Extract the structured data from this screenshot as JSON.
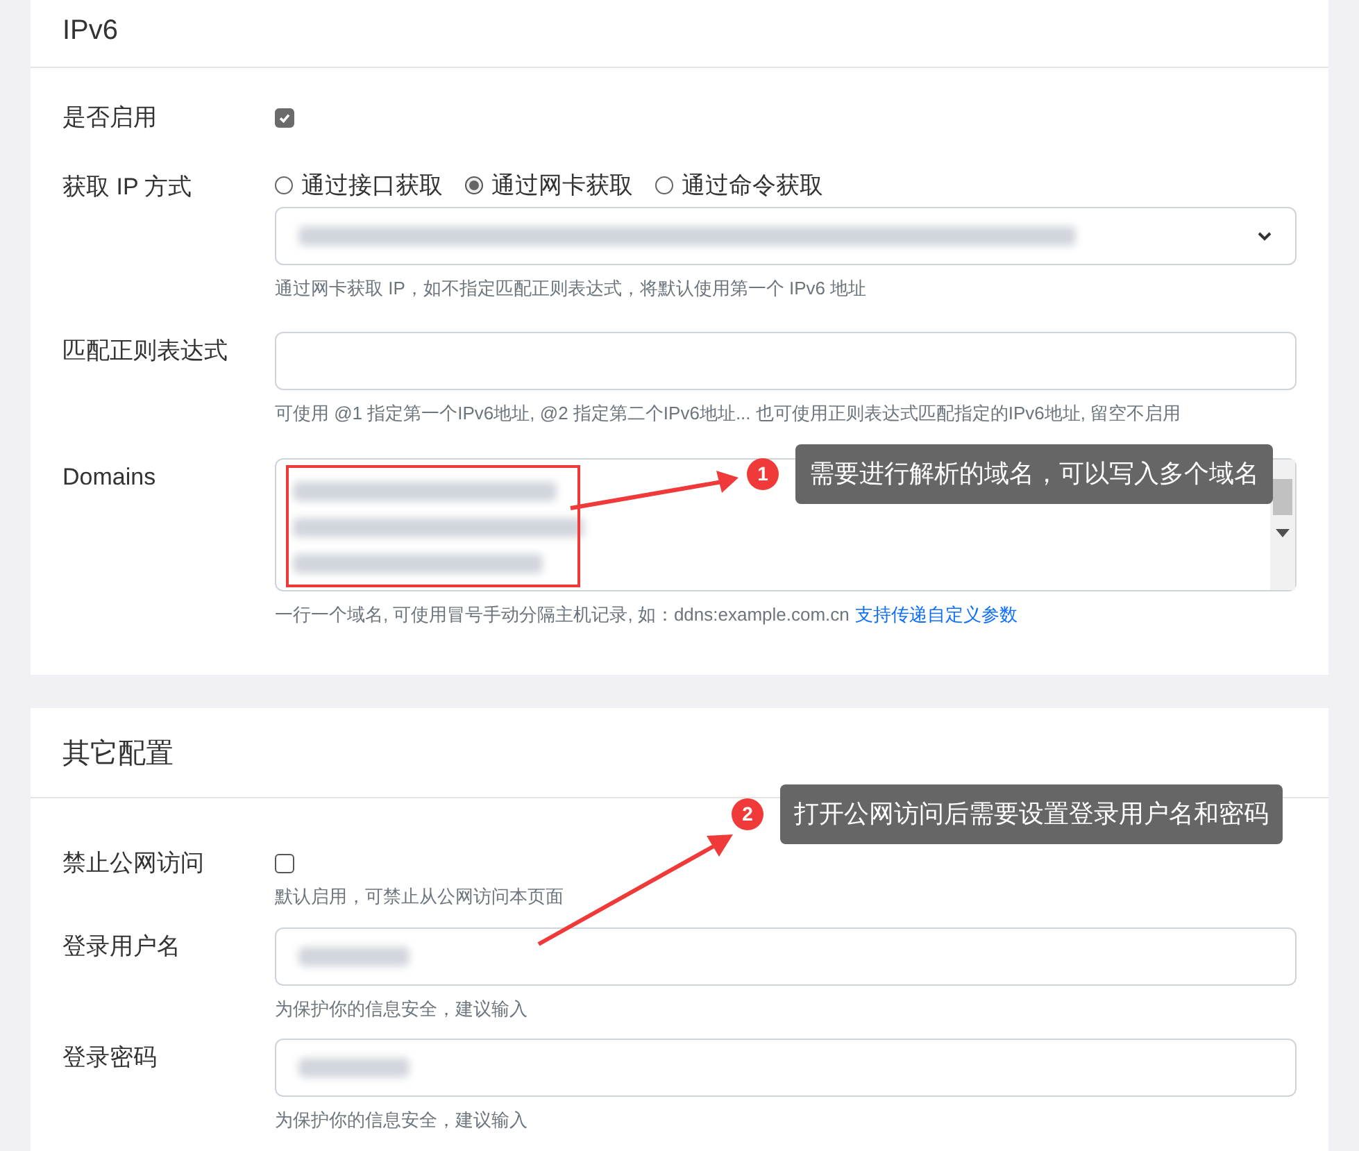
{
  "sections": [
    {
      "title": "IPv6",
      "fields": [
        {
          "kind": "checkbox",
          "label": "是否启用",
          "checked": true
        },
        {
          "kind": "radio-select",
          "label": "获取 IP 方式",
          "options": [
            {
              "label": "通过接口获取",
              "selected": false
            },
            {
              "label": "通过网卡获取",
              "selected": true
            },
            {
              "label": "通过命令获取",
              "selected": false
            }
          ],
          "help": "通过网卡获取 IP，如不指定匹配正则表达式，将默认使用第一个 IPv6 地址"
        },
        {
          "kind": "text",
          "label": "匹配正则表达式",
          "help": "可使用 @1 指定第一个IPv6地址, @2 指定第二个IPv6地址... 也可使用正则表达式匹配指定的IPv6地址, 留空不启用"
        },
        {
          "kind": "textarea",
          "label": "Domains",
          "help": "一行一个域名, 可使用冒号手动分隔主机记录, 如：ddns:example.com.cn",
          "link": "支持传递自定义参数"
        }
      ]
    },
    {
      "title": "其它配置",
      "fields": [
        {
          "kind": "checkbox",
          "label": "禁止公网访问",
          "checked": false,
          "help": "默认启用，可禁止从公网访问本页面"
        },
        {
          "kind": "text",
          "label": "登录用户名",
          "help": "为保护你的信息安全，建议输入",
          "redacted": true
        },
        {
          "kind": "text",
          "label": "登录密码",
          "help": "为保护你的信息安全，建议输入",
          "redacted": true
        }
      ]
    }
  ],
  "annotations": [
    {
      "number": "1",
      "text": "需要进行解析的域名，可以写入多个域名"
    },
    {
      "number": "2",
      "text": "打开公网访问后需要设置登录用户名和密码"
    }
  ]
}
